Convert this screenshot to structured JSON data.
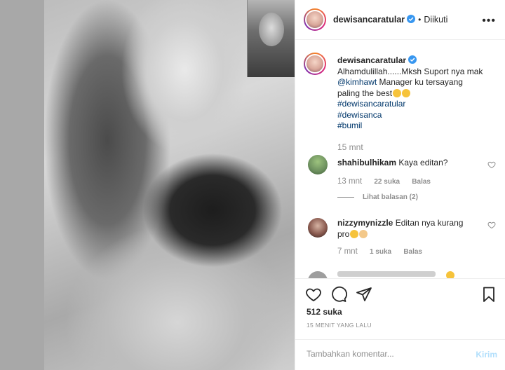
{
  "post": {
    "username": "dewisancaratular",
    "follow_separator": "•",
    "follow_state": "Diikuti",
    "more_icon": "more-horizontal-icon",
    "verified_icon": "verified-badge-icon"
  },
  "caption": {
    "username": "dewisancaratular",
    "line1": "Alhamdulillah......Mksh Suport nya mak",
    "mention": "@kimhawt",
    "line2": " Manager ku tersayang",
    "line3": "paling the best",
    "hashtags": [
      "#dewisancaratular",
      "#dewisanca",
      "#bumil"
    ],
    "time": "15 mnt"
  },
  "comments": [
    {
      "username": "shahibulhikam",
      "text": "Kaya editan?",
      "time": "13 mnt",
      "likes": "22 suka",
      "reply_label": "Balas",
      "view_replies": "Lihat balasan (2)",
      "avatar_color": "#6c8f5e"
    },
    {
      "username": "nizzymynizzle",
      "text": "Editan nya kurang",
      "text_line2": "pro",
      "time": "7 mnt",
      "likes": "1 suka",
      "reply_label": "Balas",
      "avatar_color": "#5a3b38"
    }
  ],
  "actions": {
    "like_icon": "heart-icon",
    "comment_icon": "comment-icon",
    "share_icon": "share-icon",
    "save_icon": "bookmark-icon",
    "likes_count": "512 suka",
    "post_time": "15 MENIT YANG LALU"
  },
  "add_comment": {
    "placeholder": "Tambahkan komentar...",
    "post_label": "Kirim"
  },
  "colors": {
    "verified": "#3897f0",
    "link": "#00376b",
    "muted": "#8e8e8e",
    "post_disabled": "#b2dffc"
  }
}
